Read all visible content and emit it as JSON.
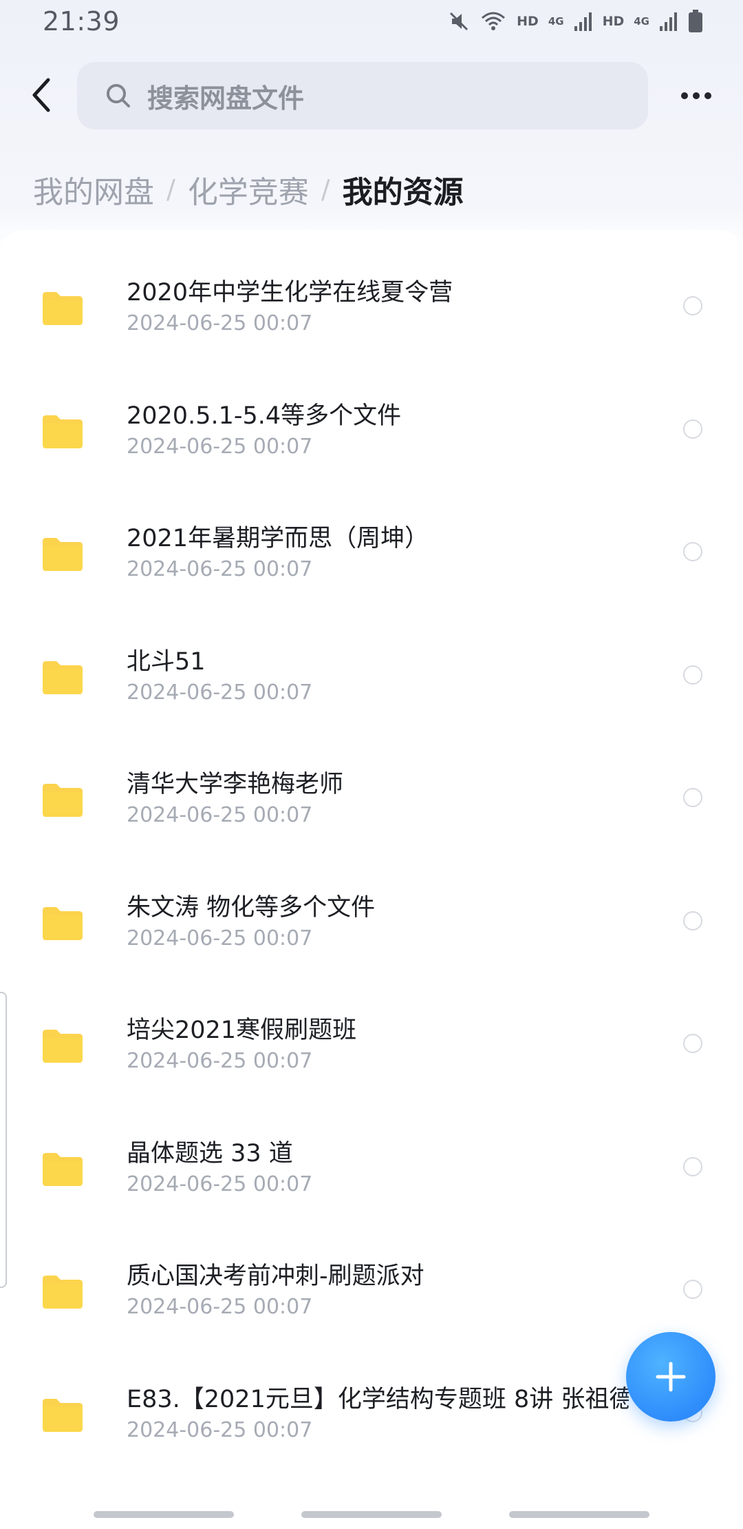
{
  "status_bar": {
    "time": "21:39",
    "hd1": "HD",
    "net1": "4G",
    "hd2": "HD",
    "net2": "4G",
    "icons": [
      "mute-icon",
      "wifi-icon",
      "signal-icon",
      "battery-icon"
    ]
  },
  "search": {
    "placeholder": "搜索网盘文件"
  },
  "breadcrumb": {
    "items": [
      "我的网盘",
      "化学竞赛",
      "我的资源"
    ],
    "separator": "/"
  },
  "files": [
    {
      "name": "2020年中学生化学在线夏令营",
      "date": "2024-06-25  00:07"
    },
    {
      "name": "2020.5.1-5.4等多个文件",
      "date": "2024-06-25  00:07"
    },
    {
      "name": "2021年暑期学而思（周坤）",
      "date": "2024-06-25  00:07"
    },
    {
      "name": "北斗51",
      "date": "2024-06-25  00:07"
    },
    {
      "name": "清华大学李艳梅老师",
      "date": "2024-06-25  00:07"
    },
    {
      "name": "朱文涛 物化等多个文件",
      "date": "2024-06-25  00:07"
    },
    {
      "name": "培尖2021寒假刷题班",
      "date": "2024-06-25  00:07"
    },
    {
      "name": "晶体题选 33 道",
      "date": "2024-06-25  00:07"
    },
    {
      "name": "质心国决考前冲刺-刷题派对",
      "date": "2024-06-25  00:07"
    },
    {
      "name": "E83.【2021元旦】化学结构专题班 8讲 张祖德",
      "date": "2024-06-25  00:07"
    }
  ],
  "colors": {
    "folder": "#fcd34d",
    "accent": "#2f8dfb",
    "muted_text": "#a6abb4"
  }
}
